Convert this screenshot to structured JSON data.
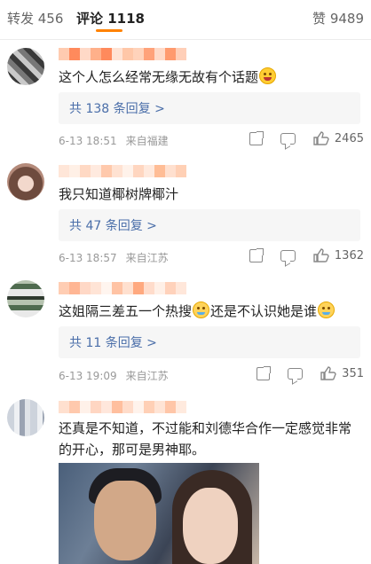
{
  "tabs": {
    "repost": "转发 456",
    "comment": "评论 1118",
    "like": "赞 9489"
  },
  "comments": [
    {
      "text": "这个人怎么经常无缘无故有个话题",
      "replies": "共 138 条回复 >",
      "time": "6-13 18:51",
      "location": "来自福建",
      "likes": "2465",
      "name_colors": [
        "#ffcbb0",
        "#ff8a5c",
        "#ffd9c7",
        "#ffb08a",
        "#ff8a5c",
        "#ffe3d4",
        "#ffc7a8",
        "#ffd3bb",
        "#ffa27a",
        "#ffdac8",
        "#ff9a6e",
        "#ffcfb8"
      ]
    },
    {
      "text": "我只知道椰树牌椰汁",
      "replies": "共 47 条回复 >",
      "time": "6-13 18:57",
      "location": "来自江苏",
      "likes": "1362",
      "name_colors": [
        "#ffe6d8",
        "#fff0e6",
        "#ffd9c4",
        "#ffeadf",
        "#ffc9ac",
        "#ffe2d2",
        "#fff2ea",
        "#ffd6c0",
        "#ffe9dd",
        "#ffbd96",
        "#ffe0cf",
        "#ffd0b5"
      ]
    },
    {
      "text": "这姐隔三差五一个热搜",
      "text2": "还是不认识她是谁",
      "replies": "共 11 条回复 >",
      "time": "6-13 19:09",
      "location": "来自江苏",
      "likes": "351",
      "name_colors": [
        "#ffcdb3",
        "#ffb694",
        "#ffd8c6",
        "#ffe4d6",
        "#fff5ef",
        "#ffc3a4",
        "#ffe0cf",
        "#ffa97f",
        "#ffdccb",
        "#fff0e7",
        "#ffd2bb",
        "#ffe7da"
      ]
    },
    {
      "text": "还真是不知道，不过能和刘德华合作一定感觉非常的开心，那可是男神耶。",
      "name_colors": [
        "#ffe0cf",
        "#ffc9ad",
        "#fff1e9",
        "#ffd6c2",
        "#ffe7dc",
        "#ffbf9e",
        "#ffdcca",
        "#fff3ec",
        "#ffd0b6",
        "#ffe4d5",
        "#ffc6a8",
        "#ffeade"
      ]
    }
  ]
}
